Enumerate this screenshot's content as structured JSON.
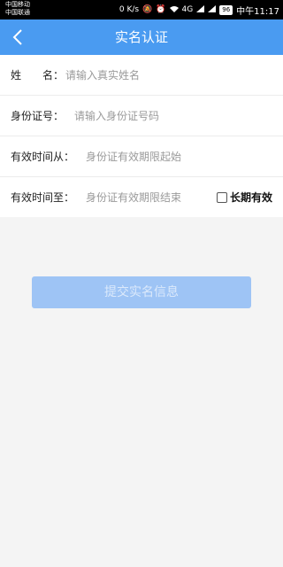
{
  "statusbar": {
    "carrier1": "中国移动",
    "carrier2": "中国联通",
    "speed": "0 K/s",
    "signal": "4G",
    "battery": "96",
    "time": "中午11:17"
  },
  "navbar": {
    "title": "实名认证"
  },
  "form": {
    "name_label": "姓　　名：",
    "name_placeholder": "请输入真实姓名",
    "idno_label": "身份证号：",
    "idno_placeholder": "请输入身份证号码",
    "from_label": "有效时间从：",
    "from_placeholder": "身份证有效期限起始",
    "to_label": "有效时间至：",
    "to_placeholder": "身份证有效期限结束",
    "longterm_label": "长期有效"
  },
  "submit": {
    "label": "提交实名信息"
  },
  "colors": {
    "primary": "#4a9bf1",
    "button_disabled": "#9ec4f5"
  }
}
